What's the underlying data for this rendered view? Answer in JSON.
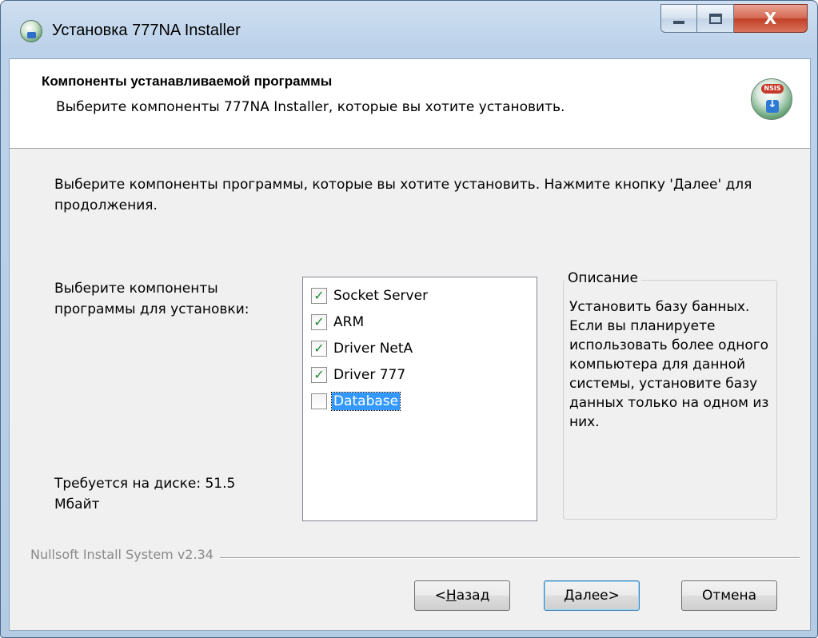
{
  "window": {
    "title": "Установка 777NA Installer",
    "controls": {
      "minimize_icon": "minimize-icon",
      "maximize_icon": "maximize-icon",
      "close_icon": "close-icon",
      "close_label": "X"
    }
  },
  "header": {
    "title": "Компоненты устанавливаемой программы",
    "subtitle": "Выберите компоненты 777NA Installer, которые вы хотите установить.",
    "icon_badge": "NSIS"
  },
  "intro": "Выберите компоненты программы, которые вы хотите установить. Нажмите кнопку 'Далее' для продолжения.",
  "select_label": "Выберите компоненты программы для установки:",
  "disk_space": "Требуется на диске: 51.5 Мбайт",
  "components": [
    {
      "label": "Socket Server",
      "checked": true,
      "selected": false
    },
    {
      "label": "ARM",
      "checked": true,
      "selected": false
    },
    {
      "label": "Driver NetA",
      "checked": true,
      "selected": false
    },
    {
      "label": "Driver 777",
      "checked": true,
      "selected": false
    },
    {
      "label": "Database",
      "checked": false,
      "selected": true
    }
  ],
  "description": {
    "legend": "Описание",
    "text": "Установить базу банных. Если вы планируете использовать более одного компьютера для данной системы, установите базу данных только на одном из них."
  },
  "footer": {
    "brand": "Nullsoft Install System v2.34"
  },
  "buttons": {
    "back": {
      "prefix": "< ",
      "accel": "Н",
      "rest": "азад"
    },
    "next": {
      "accel": "Д",
      "rest": "алее",
      "suffix": " >"
    },
    "cancel": "Отмена"
  },
  "colors": {
    "selection": "#3399ff",
    "check": "#1c8a32",
    "close_button": "#c2412a"
  }
}
